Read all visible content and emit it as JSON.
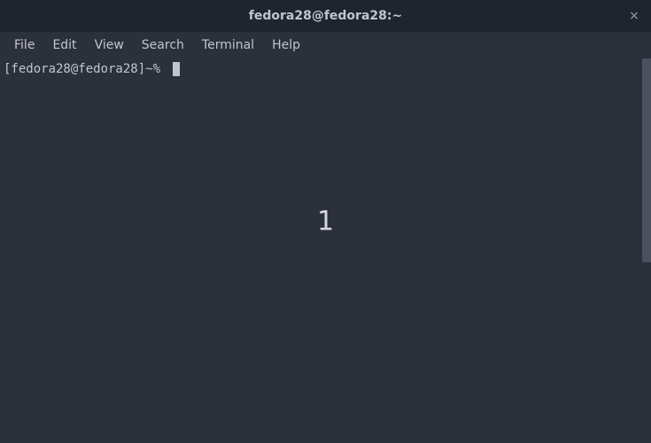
{
  "titlebar": {
    "title": "fedora28@fedora28:~",
    "close_glyph": "×"
  },
  "menubar": {
    "items": [
      "File",
      "Edit",
      "View",
      "Search",
      "Terminal",
      "Help"
    ]
  },
  "terminal": {
    "prompt": "[fedora28@fedora28]~% "
  },
  "overlay": {
    "number": "1"
  }
}
